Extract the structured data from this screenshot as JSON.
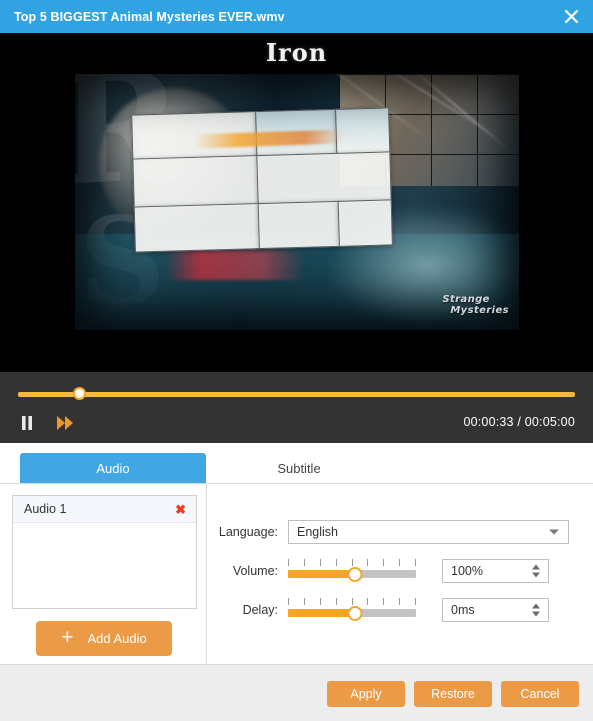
{
  "titlebar": {
    "title": "Top 5 BIGGEST Animal Mysteries EVER.wmv",
    "close_icon": "close-icon",
    "background_color": "#32a3e2"
  },
  "video": {
    "heading": "Iron",
    "watermark_line1": "Strange",
    "watermark_line2": "Mysteries",
    "background_color": "#000000"
  },
  "player": {
    "seek_percent": 11,
    "pause_icon": "pause-icon",
    "forward_icon": "fast-forward-icon",
    "current_time": "00:00:33",
    "separator": "/",
    "total_time": "00:05:00",
    "timecode": "00:00:33 / 00:05:00",
    "accent_color": "#f5b841",
    "bar_color": "#333333"
  },
  "tabs": {
    "items": [
      {
        "label": "Audio",
        "active": true
      },
      {
        "label": "Subtitle",
        "active": false
      }
    ],
    "active_color": "#41a6e4"
  },
  "audio_panel": {
    "list": [
      {
        "label": "Audio 1",
        "remove_icon": "close-icon",
        "remove_glyph": "✖"
      }
    ],
    "add_button": {
      "label": "Add Audio",
      "plus_icon": "plus-icon",
      "plus_glyph": "+"
    }
  },
  "form": {
    "language": {
      "label": "Language:",
      "value": "English",
      "caret_icon": "chevron-down-icon"
    },
    "volume": {
      "label": "Volume:",
      "slider_percent": 52,
      "value": "100%",
      "tick_count": 9
    },
    "delay": {
      "label": "Delay:",
      "slider_percent": 52,
      "value": "0ms",
      "tick_count": 9
    },
    "accent_color": "#f5a623"
  },
  "footer": {
    "buttons": [
      {
        "label": "Apply"
      },
      {
        "label": "Restore"
      },
      {
        "label": "Cancel"
      }
    ],
    "button_color": "#eb9a46"
  }
}
